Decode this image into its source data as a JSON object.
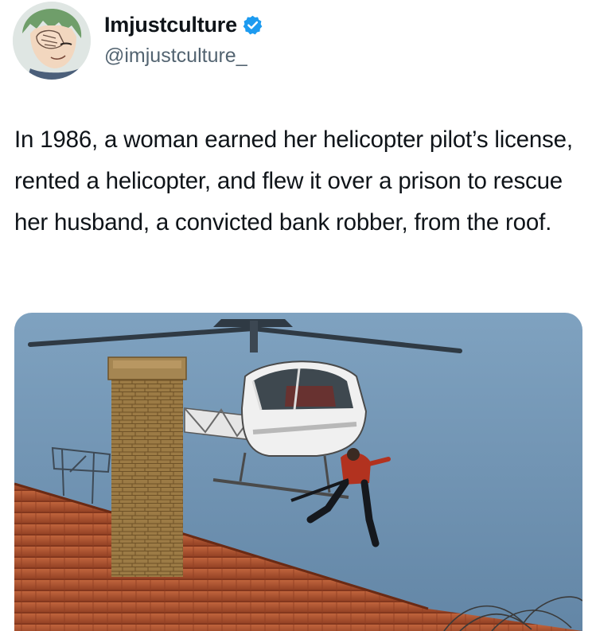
{
  "post": {
    "author": {
      "display_name": "Imjustculture",
      "handle": "@imjustculture_",
      "verified": true,
      "avatar_icon": "anime-character-avatar"
    },
    "text": "In 1986, a woman earned her helicopter pilot’s license, rented a helicopter, and flew it over a prison to rescue her husband, a convicted bank robber, from the roof.",
    "media": {
      "type": "photo",
      "subject": "helicopter-over-prison-roof-photo"
    }
  },
  "colors": {
    "text_primary": "#0f1419",
    "text_secondary": "#536471",
    "verified_badge": "#1d9bf0",
    "sky": "#6f93b3",
    "roof_tiles": "#b5532f",
    "chimney_brick": "#8a6a3a"
  }
}
